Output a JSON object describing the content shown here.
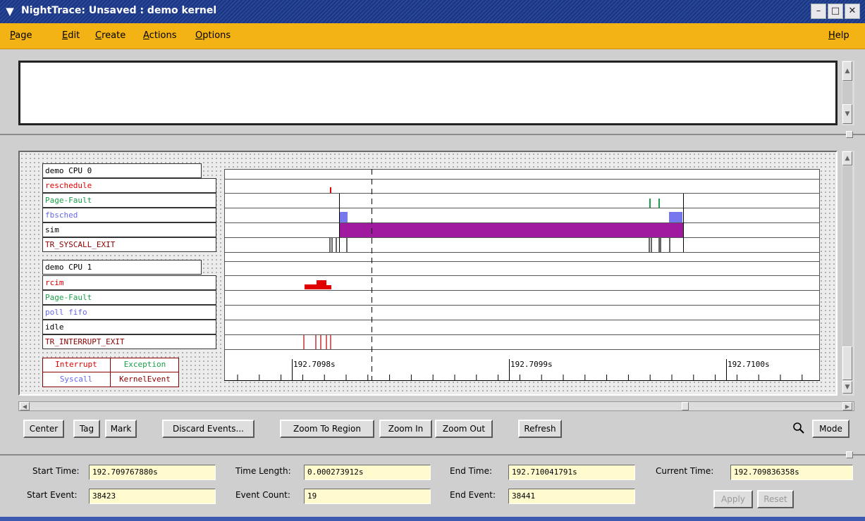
{
  "window": {
    "title": "NightTrace: Unsaved : demo kernel"
  },
  "menu": {
    "items": [
      "Page",
      "Edit",
      "Create",
      "Actions",
      "Options"
    ],
    "help": "Help"
  },
  "timeline": {
    "groups": [
      {
        "name": "demo CPU 0",
        "rows": [
          {
            "label": "reschedule",
            "color": "#e00000"
          },
          {
            "label": "Page-Fault",
            "color": "#1aa04a"
          },
          {
            "label": "fbsched",
            "color": "#6666ee"
          },
          {
            "label": "sim",
            "color": "#000000"
          },
          {
            "label": "TR_SYSCALL_EXIT",
            "color": "#8b0000"
          }
        ]
      },
      {
        "name": "demo CPU 1",
        "rows": [
          {
            "label": "rcim",
            "color": "#e00000"
          },
          {
            "label": "Page-Fault",
            "color": "#1aa04a"
          },
          {
            "label": "poll fifo",
            "color": "#6666ee"
          },
          {
            "label": "idle",
            "color": "#000000"
          },
          {
            "label": "TR_INTERRUPT_EXIT",
            "color": "#8b0000"
          }
        ]
      }
    ],
    "legend": [
      {
        "label": "Interrupt",
        "color": "#e00000"
      },
      {
        "label": "Exception",
        "color": "#1aa04a"
      },
      {
        "label": "Syscall",
        "color": "#6666ee"
      },
      {
        "label": "KernelEvent",
        "color": "#8b0000"
      }
    ],
    "axis_ticks": [
      "192.7098s",
      "192.7099s",
      "192.7100s"
    ],
    "colors": {
      "sim_bar": "#a01aa0",
      "fbsched_block": "#7777ee"
    }
  },
  "buttons": {
    "center": "Center",
    "tag": "Tag",
    "mark": "Mark",
    "discard": "Discard Events...",
    "zoom_region": "Zoom To Region",
    "zoom_in": "Zoom In",
    "zoom_out": "Zoom Out",
    "refresh": "Refresh",
    "mode": "Mode"
  },
  "fields": {
    "start_time_label": "Start Time:",
    "start_time": "192.709767880s",
    "time_length_label": "Time Length:",
    "time_length": "0.000273912s",
    "end_time_label": "End Time:",
    "end_time": "192.710041791s",
    "current_time_label": "Current Time:",
    "current_time": "192.709836358s",
    "start_event_label": "Start Event:",
    "start_event": "38423",
    "event_count_label": "Event Count:",
    "event_count": "19",
    "end_event_label": "End Event:",
    "end_event": "38441",
    "apply": "Apply",
    "reset": "Reset"
  }
}
